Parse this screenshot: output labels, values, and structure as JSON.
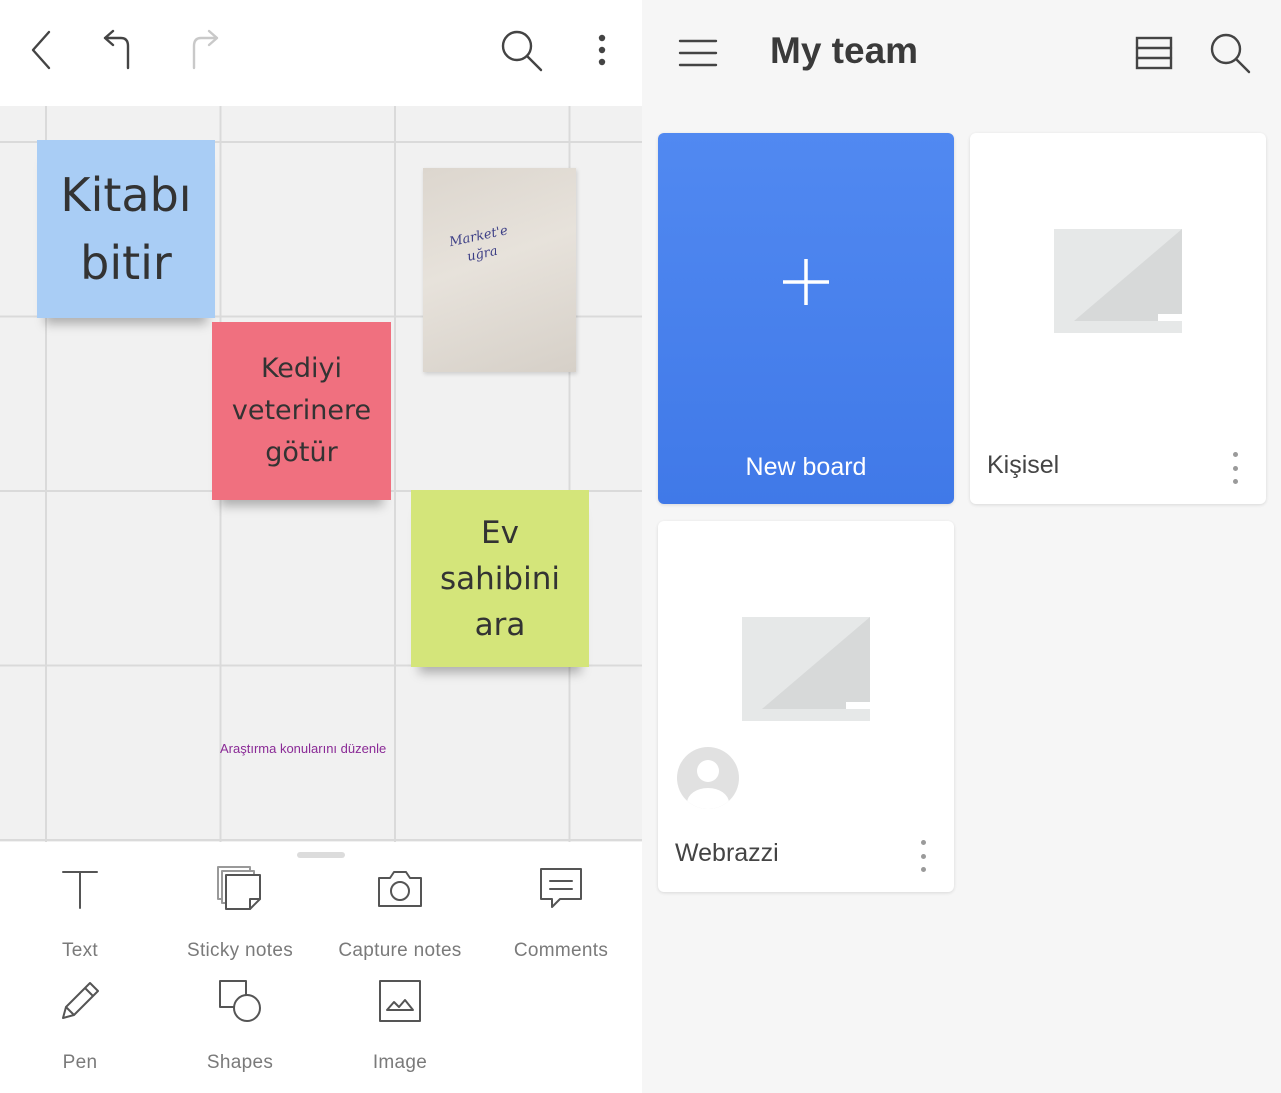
{
  "left_pane": {
    "toolbar": {
      "back_icon": "chevron-left-icon",
      "undo_icon": "undo-icon",
      "redo_icon": "redo-icon",
      "search_icon": "search-icon",
      "more_icon": "more-vertical-icon"
    },
    "canvas": {
      "sticky_notes": [
        {
          "text": "Kitabı\nbitir",
          "color": "#a9cdf5"
        },
        {
          "text": "Kediyi\nveterinere\ngötür",
          "color": "#f0707f"
        },
        {
          "text": "Ev\nsahibini\nara",
          "color": "#d4e57a"
        }
      ],
      "photo_note": {
        "handwriting": "Market'e\nuğra"
      },
      "free_text": "Araştırma konularını düzenle"
    },
    "tools": [
      {
        "label": "Text",
        "icon": "text-icon"
      },
      {
        "label": "Sticky notes",
        "icon": "sticky-notes-icon"
      },
      {
        "label": "Capture notes",
        "icon": "camera-icon"
      },
      {
        "label": "Comments",
        "icon": "comment-icon"
      },
      {
        "label": "Pen",
        "icon": "pen-icon"
      },
      {
        "label": "Shapes",
        "icon": "shapes-icon"
      },
      {
        "label": "Image",
        "icon": "image-icon"
      }
    ]
  },
  "right_pane": {
    "title": "My team",
    "menu_icon": "hamburger-icon",
    "view_icon": "list-view-icon",
    "search_icon": "search-icon",
    "accent_color": "#4a82ee",
    "boards": [
      {
        "label": "New board",
        "type": "new"
      },
      {
        "label": "Kişisel",
        "type": "board"
      },
      {
        "label": "Webrazzi",
        "type": "board",
        "has_avatar": true
      }
    ]
  }
}
